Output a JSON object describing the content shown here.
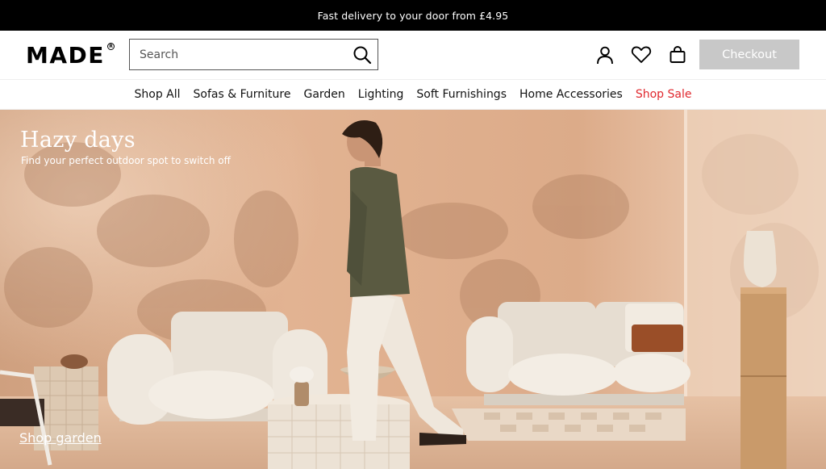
{
  "promo": {
    "text": "Fast delivery to your door from £4.95"
  },
  "header": {
    "logo": "MADE",
    "logo_mark": "R",
    "search": {
      "placeholder": "Search",
      "value": ""
    },
    "icons": [
      "search-icon",
      "account-icon",
      "wishlist-heart-icon",
      "basket-bag-icon"
    ],
    "checkout_label": "Checkout"
  },
  "nav": {
    "items": [
      {
        "label": "Shop All"
      },
      {
        "label": "Sofas & Furniture"
      },
      {
        "label": "Garden"
      },
      {
        "label": "Lighting"
      },
      {
        "label": "Soft Furnishings"
      },
      {
        "label": "Home Accessories"
      },
      {
        "label": "Shop Sale"
      }
    ]
  },
  "hero": {
    "title": "Hazy days",
    "subtitle": "Find your perfect outdoor spot to switch off",
    "cta": "Shop garden"
  },
  "colors": {
    "promo_bg": "#000000",
    "sale_red": "#e0282e",
    "checkout_disabled": "#c8c8c8",
    "hero_wall": "#d9a98a"
  }
}
